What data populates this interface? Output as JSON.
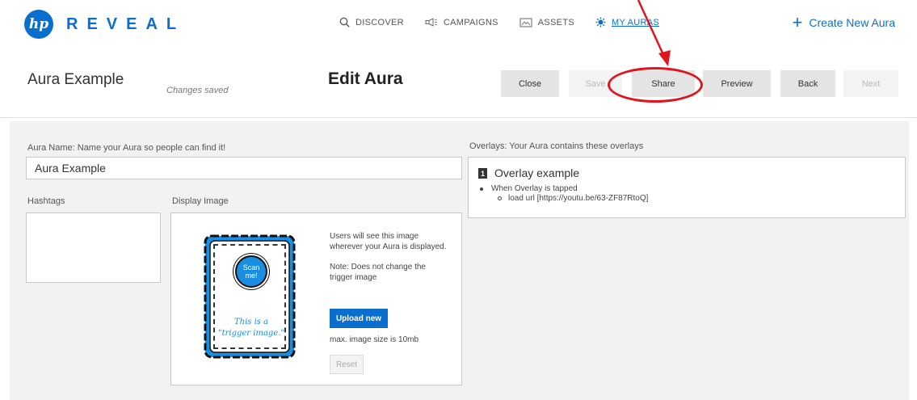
{
  "brand": {
    "logo_text": "hp",
    "name": "REVEAL"
  },
  "nav": {
    "items": [
      {
        "label": "DISCOVER",
        "icon": "search-icon"
      },
      {
        "label": "CAMPAIGNS",
        "icon": "megaphone-icon"
      },
      {
        "label": "ASSETS",
        "icon": "image-icon"
      },
      {
        "label": "MY AURAS",
        "icon": "aura-icon",
        "active": true
      }
    ],
    "create_label": "Create New Aura"
  },
  "header": {
    "aura_title": "Aura Example",
    "status": "Changes saved",
    "page_title": "Edit Aura"
  },
  "toolbar": {
    "close": "Close",
    "save": "Save",
    "share": "Share",
    "preview": "Preview",
    "back": "Back",
    "next": "Next"
  },
  "form": {
    "aura_name_label": "Aura Name: Name your Aura so people can find it!",
    "aura_name_value": "Aura Example",
    "hashtags_label": "Hashtags",
    "display_image_label": "Display Image",
    "thumbnail": {
      "circle_text": "Scan me!",
      "caption_line1": "This is a",
      "caption_line2": "\"trigger image.\""
    },
    "display_info": "Users will see this image wherever your Aura is displayed.",
    "display_note": "Note: Does not change the trigger image",
    "upload_label": "Upload new",
    "max_size": "max. image size is 10mb",
    "reset_label": "Reset"
  },
  "overlays": {
    "label": "Overlays: Your Aura contains these overlays",
    "items": [
      {
        "number": "1",
        "title": "Overlay example",
        "trigger": "When Overlay is tapped",
        "action": "load url [https://youtu.be/63-ZF87RtoQ]"
      }
    ]
  },
  "colors": {
    "accent": "#0a6ecf",
    "callout": "#e0141f",
    "panel_bg": "#f2f2f2"
  }
}
